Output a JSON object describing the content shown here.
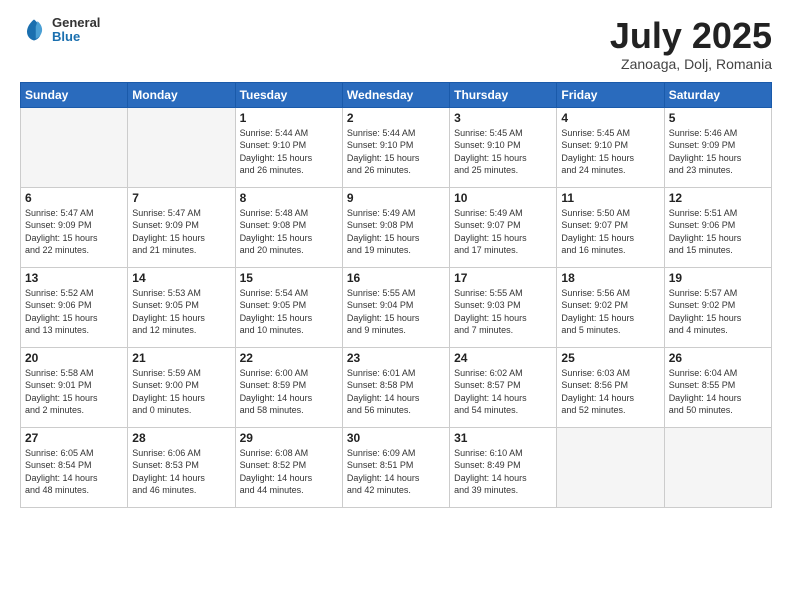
{
  "header": {
    "logo": {
      "general": "General",
      "blue": "Blue"
    },
    "title": "July 2025",
    "location": "Zanoaga, Dolj, Romania"
  },
  "weekdays": [
    "Sunday",
    "Monday",
    "Tuesday",
    "Wednesday",
    "Thursday",
    "Friday",
    "Saturday"
  ],
  "weeks": [
    [
      {
        "day": "",
        "info": ""
      },
      {
        "day": "",
        "info": ""
      },
      {
        "day": "1",
        "info": "Sunrise: 5:44 AM\nSunset: 9:10 PM\nDaylight: 15 hours\nand 26 minutes."
      },
      {
        "day": "2",
        "info": "Sunrise: 5:44 AM\nSunset: 9:10 PM\nDaylight: 15 hours\nand 26 minutes."
      },
      {
        "day": "3",
        "info": "Sunrise: 5:45 AM\nSunset: 9:10 PM\nDaylight: 15 hours\nand 25 minutes."
      },
      {
        "day": "4",
        "info": "Sunrise: 5:45 AM\nSunset: 9:10 PM\nDaylight: 15 hours\nand 24 minutes."
      },
      {
        "day": "5",
        "info": "Sunrise: 5:46 AM\nSunset: 9:09 PM\nDaylight: 15 hours\nand 23 minutes."
      }
    ],
    [
      {
        "day": "6",
        "info": "Sunrise: 5:47 AM\nSunset: 9:09 PM\nDaylight: 15 hours\nand 22 minutes."
      },
      {
        "day": "7",
        "info": "Sunrise: 5:47 AM\nSunset: 9:09 PM\nDaylight: 15 hours\nand 21 minutes."
      },
      {
        "day": "8",
        "info": "Sunrise: 5:48 AM\nSunset: 9:08 PM\nDaylight: 15 hours\nand 20 minutes."
      },
      {
        "day": "9",
        "info": "Sunrise: 5:49 AM\nSunset: 9:08 PM\nDaylight: 15 hours\nand 19 minutes."
      },
      {
        "day": "10",
        "info": "Sunrise: 5:49 AM\nSunset: 9:07 PM\nDaylight: 15 hours\nand 17 minutes."
      },
      {
        "day": "11",
        "info": "Sunrise: 5:50 AM\nSunset: 9:07 PM\nDaylight: 15 hours\nand 16 minutes."
      },
      {
        "day": "12",
        "info": "Sunrise: 5:51 AM\nSunset: 9:06 PM\nDaylight: 15 hours\nand 15 minutes."
      }
    ],
    [
      {
        "day": "13",
        "info": "Sunrise: 5:52 AM\nSunset: 9:06 PM\nDaylight: 15 hours\nand 13 minutes."
      },
      {
        "day": "14",
        "info": "Sunrise: 5:53 AM\nSunset: 9:05 PM\nDaylight: 15 hours\nand 12 minutes."
      },
      {
        "day": "15",
        "info": "Sunrise: 5:54 AM\nSunset: 9:05 PM\nDaylight: 15 hours\nand 10 minutes."
      },
      {
        "day": "16",
        "info": "Sunrise: 5:55 AM\nSunset: 9:04 PM\nDaylight: 15 hours\nand 9 minutes."
      },
      {
        "day": "17",
        "info": "Sunrise: 5:55 AM\nSunset: 9:03 PM\nDaylight: 15 hours\nand 7 minutes."
      },
      {
        "day": "18",
        "info": "Sunrise: 5:56 AM\nSunset: 9:02 PM\nDaylight: 15 hours\nand 5 minutes."
      },
      {
        "day": "19",
        "info": "Sunrise: 5:57 AM\nSunset: 9:02 PM\nDaylight: 15 hours\nand 4 minutes."
      }
    ],
    [
      {
        "day": "20",
        "info": "Sunrise: 5:58 AM\nSunset: 9:01 PM\nDaylight: 15 hours\nand 2 minutes."
      },
      {
        "day": "21",
        "info": "Sunrise: 5:59 AM\nSunset: 9:00 PM\nDaylight: 15 hours\nand 0 minutes."
      },
      {
        "day": "22",
        "info": "Sunrise: 6:00 AM\nSunset: 8:59 PM\nDaylight: 14 hours\nand 58 minutes."
      },
      {
        "day": "23",
        "info": "Sunrise: 6:01 AM\nSunset: 8:58 PM\nDaylight: 14 hours\nand 56 minutes."
      },
      {
        "day": "24",
        "info": "Sunrise: 6:02 AM\nSunset: 8:57 PM\nDaylight: 14 hours\nand 54 minutes."
      },
      {
        "day": "25",
        "info": "Sunrise: 6:03 AM\nSunset: 8:56 PM\nDaylight: 14 hours\nand 52 minutes."
      },
      {
        "day": "26",
        "info": "Sunrise: 6:04 AM\nSunset: 8:55 PM\nDaylight: 14 hours\nand 50 minutes."
      }
    ],
    [
      {
        "day": "27",
        "info": "Sunrise: 6:05 AM\nSunset: 8:54 PM\nDaylight: 14 hours\nand 48 minutes."
      },
      {
        "day": "28",
        "info": "Sunrise: 6:06 AM\nSunset: 8:53 PM\nDaylight: 14 hours\nand 46 minutes."
      },
      {
        "day": "29",
        "info": "Sunrise: 6:08 AM\nSunset: 8:52 PM\nDaylight: 14 hours\nand 44 minutes."
      },
      {
        "day": "30",
        "info": "Sunrise: 6:09 AM\nSunset: 8:51 PM\nDaylight: 14 hours\nand 42 minutes."
      },
      {
        "day": "31",
        "info": "Sunrise: 6:10 AM\nSunset: 8:49 PM\nDaylight: 14 hours\nand 39 minutes."
      },
      {
        "day": "",
        "info": ""
      },
      {
        "day": "",
        "info": ""
      }
    ]
  ]
}
